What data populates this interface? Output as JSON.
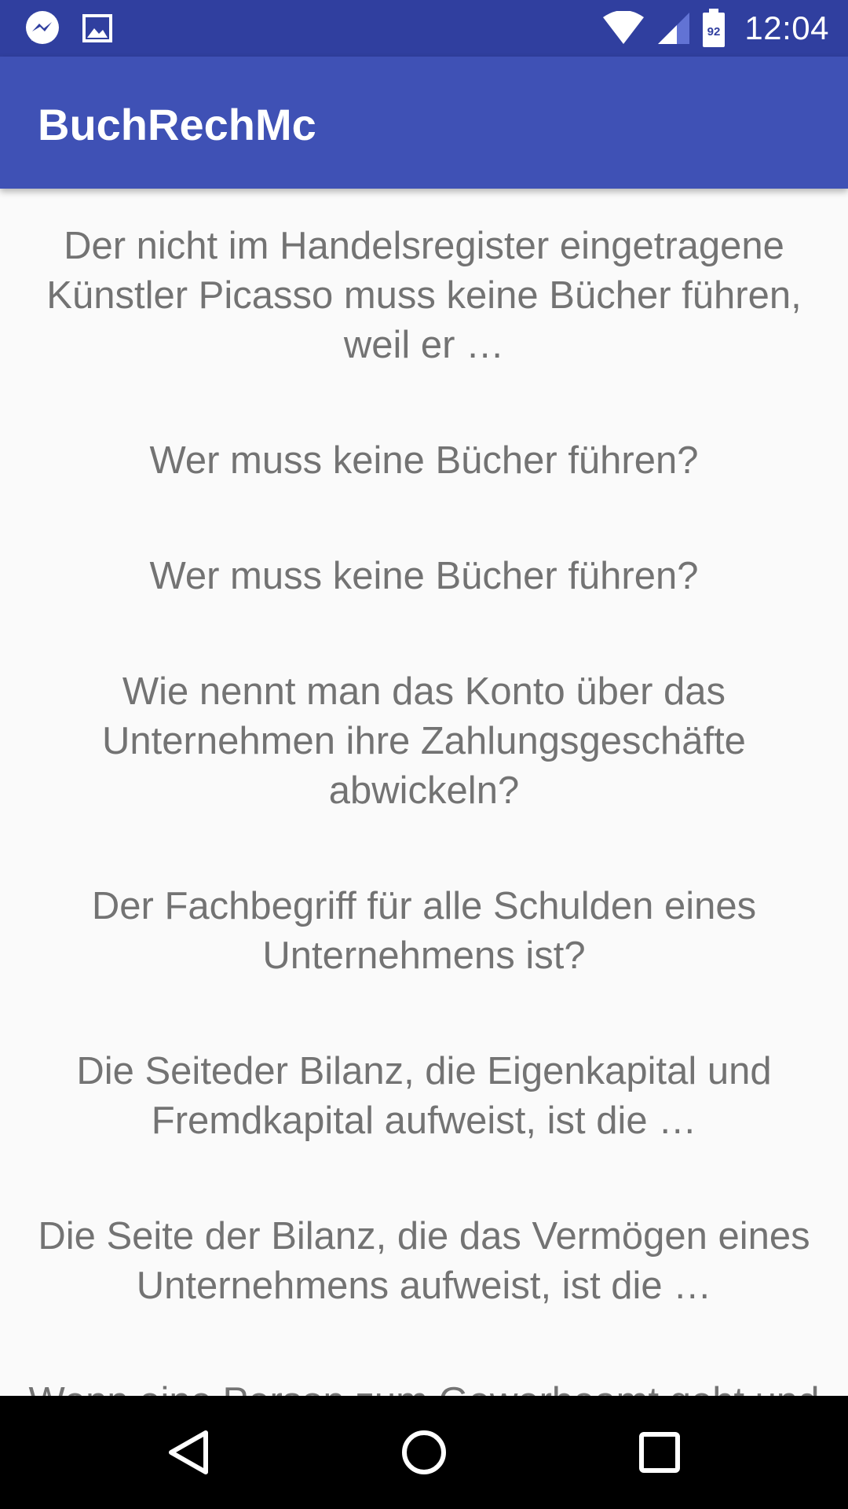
{
  "status_bar": {
    "time": "12:04",
    "battery_level": "92",
    "background_color": "#303f9f",
    "icons_left": [
      "messenger-icon",
      "image-icon"
    ],
    "icons_right": [
      "wifi-icon",
      "signal-icon",
      "battery-icon"
    ]
  },
  "app_bar": {
    "title": "BuchRechMc",
    "background_color": "#3f51b5"
  },
  "list": {
    "items": [
      {
        "text": "Der nicht im Handelsregister eingetragene Künstler Picasso muss keine Bücher führen, weil er …"
      },
      {
        "text": "Wer muss keine Bücher führen?"
      },
      {
        "text": "Wer muss keine Bücher führen?"
      },
      {
        "text": "Wie nennt man das Konto über das Unternehmen ihre Zahlungsgeschäfte abwickeln?"
      },
      {
        "text": "Der Fachbegriff für alle Schulden eines Unternehmens ist?"
      },
      {
        "text": "Die Seiteder Bilanz, die Eigenkapital und Fremdkapital aufweist, ist die …"
      },
      {
        "text": "Die Seite der Bilanz, die das Vermögen eines Unternehmens aufweist, ist die …"
      },
      {
        "text": "Wenn eine Person zum Gewerbeamt geht und ein Unternehmen anmeldet, hat das"
      }
    ],
    "text_color": "#737373"
  },
  "nav_bar": {
    "buttons": [
      "back-icon",
      "home-icon",
      "recents-icon"
    ]
  }
}
